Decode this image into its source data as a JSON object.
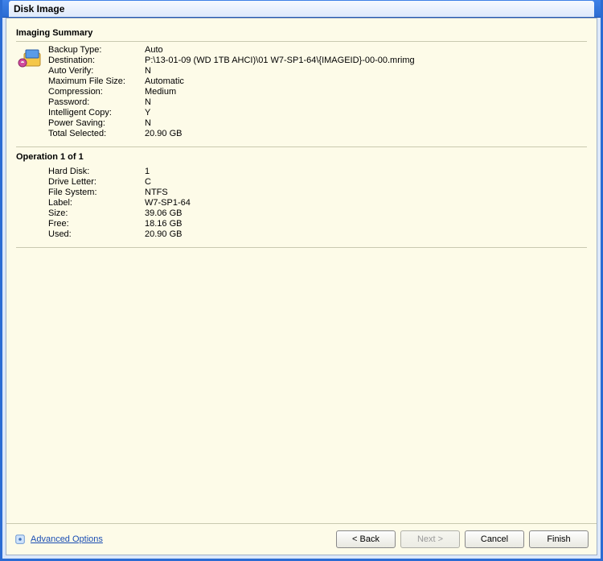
{
  "window": {
    "title": "Disk Image"
  },
  "summary": {
    "header": "Imaging Summary",
    "rows": [
      {
        "label": "Backup Type:",
        "value": "Auto"
      },
      {
        "label": "Destination:",
        "value": "P:\\13-01-09 (WD 1TB AHCI)\\01 W7-SP1-64\\{IMAGEID}-00-00.mrimg"
      },
      {
        "label": "Auto Verify:",
        "value": "N"
      },
      {
        "label": "Maximum File Size:",
        "value": "Automatic"
      },
      {
        "label": "Compression:",
        "value": "Medium"
      },
      {
        "label": "Password:",
        "value": "N"
      },
      {
        "label": "Intelligent Copy:",
        "value": "Y"
      },
      {
        "label": "Power Saving:",
        "value": "N"
      },
      {
        "label": "Total Selected:",
        "value": "20.90 GB"
      }
    ]
  },
  "operation": {
    "header": "Operation 1 of 1",
    "rows": [
      {
        "label": "Hard Disk:",
        "value": "1"
      },
      {
        "label": "Drive Letter:",
        "value": "C"
      },
      {
        "label": "File System:",
        "value": "NTFS"
      },
      {
        "label": "Label:",
        "value": "W7-SP1-64"
      },
      {
        "label": "Size:",
        "value": "39.06 GB"
      },
      {
        "label": "Free:",
        "value": "18.16 GB"
      },
      {
        "label": "Used:",
        "value": "20.90 GB"
      }
    ]
  },
  "footer": {
    "advanced": "Advanced Options",
    "back": "< Back",
    "next": "Next >",
    "cancel": "Cancel",
    "finish": "Finish"
  }
}
